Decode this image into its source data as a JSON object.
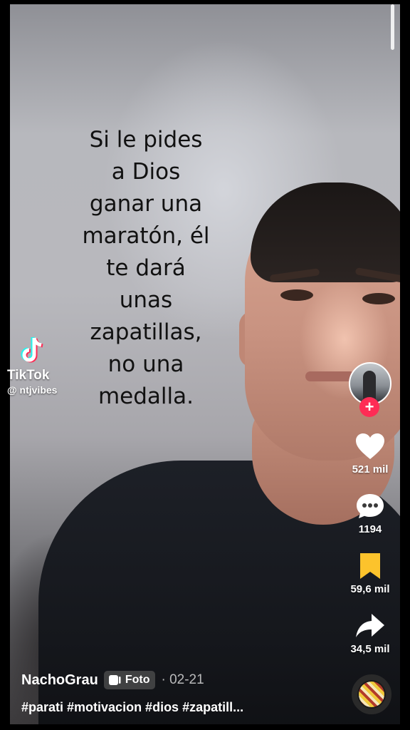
{
  "quote": {
    "lines": [
      "Si le pides",
      "a Dios",
      "ganar una",
      "maratón, él",
      "te dará",
      "unas",
      "zapatillas,",
      "no una",
      "medalla."
    ]
  },
  "watermark": {
    "brand": "TikTok",
    "handle": "@ ntjvibes",
    "logo_icon": "tiktok-logo-icon"
  },
  "actions": {
    "follow_icon": "plus-icon",
    "like": {
      "icon": "heart-icon",
      "count": "521 mil"
    },
    "comment": {
      "icon": "comment-bubble-icon",
      "count": "1194"
    },
    "save": {
      "icon": "bookmark-icon",
      "count": "59,6 mil",
      "color": "#fcc32c"
    },
    "share": {
      "icon": "share-arrow-icon",
      "count": "34,5 mil"
    }
  },
  "post": {
    "author": "NachoGrau",
    "type_badge": "Foto",
    "date": "· 02-21",
    "caption": "#parati #motivacion #dios #zapatill..."
  },
  "colors": {
    "accent": "#fe2c55",
    "text": "#ffffff"
  }
}
